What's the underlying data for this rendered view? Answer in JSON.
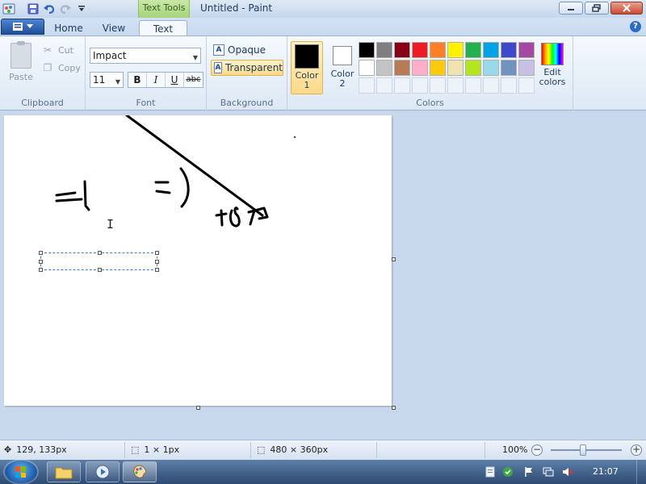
{
  "window": {
    "title": "Untitled - Paint",
    "context_tab": "Text Tools"
  },
  "tabs": {
    "home": "Home",
    "view": "View",
    "text": "Text",
    "help": "?"
  },
  "clipboard": {
    "paste": "Paste",
    "cut": "Cut",
    "copy": "Copy",
    "group_label": "Clipboard"
  },
  "font": {
    "family": "Impact",
    "size": "11",
    "bold": "B",
    "italic": "I",
    "underline": "U",
    "strikethrough": "abc",
    "group_label": "Font"
  },
  "background": {
    "opaque": "Opaque",
    "transparent": "Transparent",
    "selected": "transparent",
    "group_label": "Background"
  },
  "colors": {
    "color1_label": "Color\n1",
    "color1_value": "#000000",
    "color2_label": "Color\n2",
    "color2_value": "#ffffff",
    "edit_colors": "Edit\ncolors",
    "group_label": "Colors",
    "palette_row1": [
      "#000000",
      "#7f7f7f",
      "#880015",
      "#ed1c24",
      "#ff7f27",
      "#fff200",
      "#22b14c",
      "#00a2e8",
      "#3f48cc",
      "#a349a4"
    ],
    "palette_row2": [
      "#ffffff",
      "#c3c3c3",
      "#b97a57",
      "#ffaec9",
      "#ffc90e",
      "#efe4b0",
      "#b5e61d",
      "#99d9ea",
      "#7092be",
      "#c8bfe7"
    ]
  },
  "status": {
    "cursor_pos": "129, 133px",
    "selection_size": "1 × 1px",
    "image_size": "480 × 360px",
    "zoom": "100%",
    "zoom_minus": "−",
    "zoom_plus": "+",
    "zoom_value": 1.0
  },
  "taskbar": {
    "clock": "21:07"
  }
}
